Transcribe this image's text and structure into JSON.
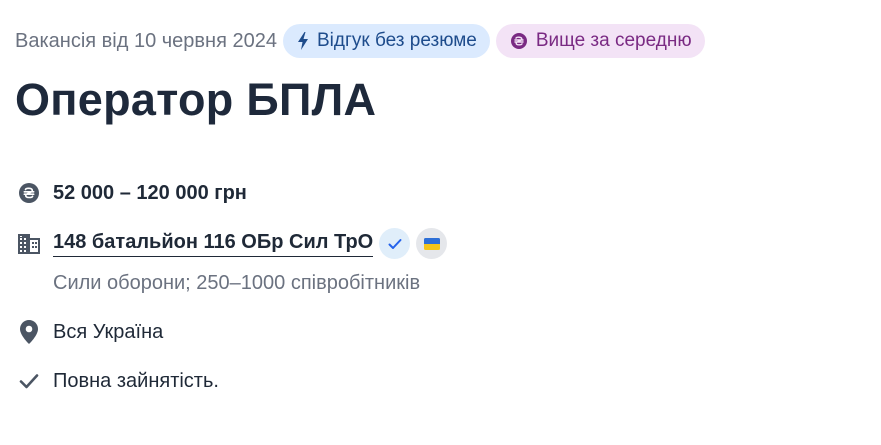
{
  "header": {
    "posted": "Вакансія від 10 червня 2024",
    "badges": [
      {
        "label": "Відгук без резюме",
        "icon": "lightning-icon"
      },
      {
        "label": "Вище за середню",
        "icon": "hryvnia-coin-icon"
      }
    ]
  },
  "job": {
    "title": "Оператор БПЛА",
    "salary": "52 000 – 120 000 грн",
    "company": {
      "name": "148 батальйон 116 ОБр Сил ТрО",
      "description": "Сили оборони; 250–1000 співробітників"
    },
    "location": "Вся Україна",
    "employment": "Повна зайнятість."
  },
  "colors": {
    "badge_blue_bg": "#dbeafe",
    "badge_blue_text": "#1e4c8c",
    "badge_purple_bg": "#f3e3f6",
    "badge_purple_text": "#7a2a83",
    "icon_gray": "#6b7280",
    "title": "#1e293b"
  }
}
